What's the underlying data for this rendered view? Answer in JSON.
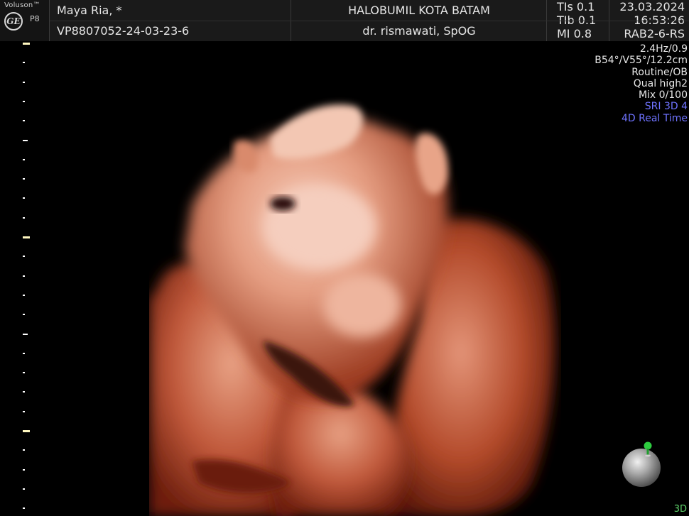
{
  "header": {
    "brand": "Voluson™",
    "probe": "P8",
    "logo_text": "GE",
    "patient_name": "Maya Ria,   *",
    "patient_id": "VP8807052-24-03-23-6",
    "institution": "HALOBUMIL KOTA BATAM",
    "doctor": "dr. rismawati, SpOG",
    "indices": [
      "TIs  0.1",
      "TIb  0.1",
      "MI  0.8"
    ],
    "date": "23.03.2024",
    "time": "16:53:26",
    "probe_model": "RAB2-6-RS"
  },
  "info_panel": {
    "lines": [
      "2.4Hz/0.9",
      "B54°/V55°/12.2cm",
      "Routine/OB",
      "Qual high2",
      "Mix 0/100"
    ],
    "highlight_lines": [
      "SRI 3D 4",
      "4D Real Time"
    ]
  },
  "render_mode": "3D",
  "colors": {
    "header_bg": "#1a1a1a",
    "highlight": "#6f73ff",
    "mode_label": "#5fd36a",
    "skin_light": "#f0bba8",
    "skin_dark": "#b24a2a",
    "orientation_pin": "#2ecc40"
  }
}
